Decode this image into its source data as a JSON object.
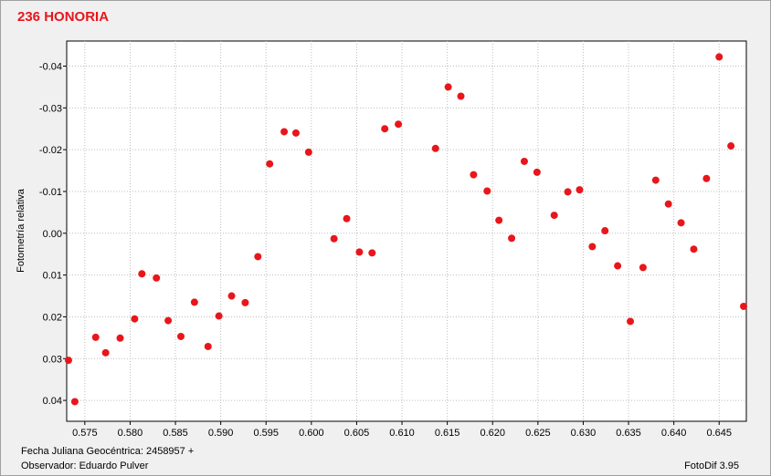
{
  "title": "236 HONORIA",
  "footer": {
    "jd_label": "Fecha Juliana Geocéntrica: 2458957 +",
    "observer_label": "Observador: Eduardo Pulver",
    "software": "FotoDif 3.95"
  },
  "colors": {
    "title": "#e8161b",
    "points": "#e8161b",
    "grid": "#bdbdbd"
  },
  "chart_data": {
    "type": "scatter",
    "title": "236 HONORIA",
    "xlabel": "",
    "ylabel": "Fotometría relativa",
    "xlim": [
      0.573,
      0.648
    ],
    "ylim": [
      0.045,
      -0.046
    ],
    "y_inverted": true,
    "grid": true,
    "x_ticks": [
      0.575,
      0.58,
      0.585,
      0.59,
      0.595,
      0.6,
      0.605,
      0.61,
      0.615,
      0.62,
      0.625,
      0.63,
      0.635,
      0.64,
      0.645
    ],
    "x_tick_labels": [
      "0.575",
      "0.580",
      "0.585",
      "0.590",
      "0.595",
      "0.600",
      "0.605",
      "0.610",
      "0.615",
      "0.620",
      "0.625",
      "0.630",
      "0.635",
      "0.640",
      "0.645"
    ],
    "y_ticks": [
      -0.04,
      -0.03,
      -0.02,
      -0.01,
      0.0,
      0.01,
      0.02,
      0.03,
      0.04
    ],
    "y_tick_labels": [
      "-0.04",
      "-0.03",
      "-0.02",
      "-0.01",
      "0.00",
      "0.01",
      "0.02",
      "0.03",
      "0.04"
    ],
    "points": [
      {
        "x": 0.5732,
        "y": 0.0304
      },
      {
        "x": 0.5739,
        "y": 0.0403
      },
      {
        "x": 0.5762,
        "y": 0.0249
      },
      {
        "x": 0.5773,
        "y": 0.0286
      },
      {
        "x": 0.5789,
        "y": 0.0251
      },
      {
        "x": 0.5805,
        "y": 0.0205
      },
      {
        "x": 0.5813,
        "y": 0.0097
      },
      {
        "x": 0.5829,
        "y": 0.0107
      },
      {
        "x": 0.5842,
        "y": 0.0209
      },
      {
        "x": 0.5856,
        "y": 0.0247
      },
      {
        "x": 0.5871,
        "y": 0.0165
      },
      {
        "x": 0.5886,
        "y": 0.0271
      },
      {
        "x": 0.5898,
        "y": 0.0198
      },
      {
        "x": 0.5912,
        "y": 0.015
      },
      {
        "x": 0.5927,
        "y": 0.0166
      },
      {
        "x": 0.5941,
        "y": 0.0056
      },
      {
        "x": 0.5954,
        "y": -0.0166
      },
      {
        "x": 0.597,
        "y": -0.0243
      },
      {
        "x": 0.5983,
        "y": -0.024
      },
      {
        "x": 0.5997,
        "y": -0.0194
      },
      {
        "x": 0.6025,
        "y": 0.0013
      },
      {
        "x": 0.6039,
        "y": -0.0035
      },
      {
        "x": 0.6053,
        "y": 0.0045
      },
      {
        "x": 0.6067,
        "y": 0.0047
      },
      {
        "x": 0.6081,
        "y": -0.025
      },
      {
        "x": 0.6096,
        "y": -0.0261
      },
      {
        "x": 0.6137,
        "y": -0.0203
      },
      {
        "x": 0.6151,
        "y": -0.035
      },
      {
        "x": 0.6165,
        "y": -0.0328
      },
      {
        "x": 0.6179,
        "y": -0.014
      },
      {
        "x": 0.6194,
        "y": -0.0101
      },
      {
        "x": 0.6207,
        "y": -0.0031
      },
      {
        "x": 0.6221,
        "y": 0.0012
      },
      {
        "x": 0.6235,
        "y": -0.0172
      },
      {
        "x": 0.6249,
        "y": -0.0146
      },
      {
        "x": 0.6268,
        "y": -0.0043
      },
      {
        "x": 0.6283,
        "y": -0.0099
      },
      {
        "x": 0.6296,
        "y": -0.0104
      },
      {
        "x": 0.631,
        "y": 0.0032
      },
      {
        "x": 0.6324,
        "y": -0.0006
      },
      {
        "x": 0.6338,
        "y": 0.0078
      },
      {
        "x": 0.6352,
        "y": 0.0211
      },
      {
        "x": 0.6366,
        "y": 0.0082
      },
      {
        "x": 0.638,
        "y": -0.0127
      },
      {
        "x": 0.6394,
        "y": -0.007
      },
      {
        "x": 0.6408,
        "y": -0.0025
      },
      {
        "x": 0.6422,
        "y": 0.0038
      },
      {
        "x": 0.6436,
        "y": -0.0131
      },
      {
        "x": 0.645,
        "y": -0.0422
      },
      {
        "x": 0.6463,
        "y": -0.0209
      },
      {
        "x": 0.6477,
        "y": 0.0175
      }
    ]
  }
}
